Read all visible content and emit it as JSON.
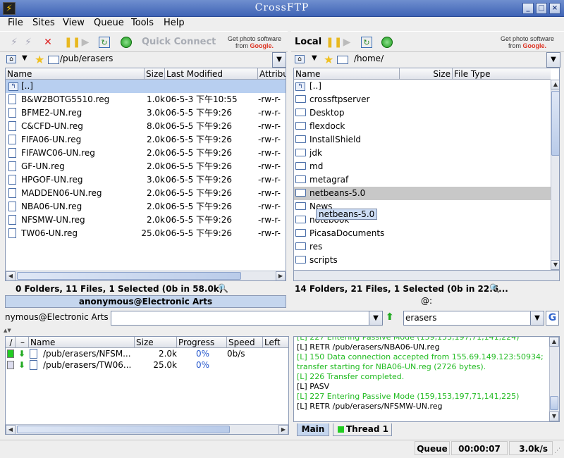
{
  "window": {
    "title": "CrossFTP",
    "app_icon": "⚡"
  },
  "menu": [
    "File",
    "Sites",
    "View",
    "Queue",
    "Tools",
    "Help"
  ],
  "remote_toolbar": {
    "quick_connect": "Quick Connect",
    "ad_line1": "Get photo software",
    "ad_line2": "from ",
    "ad_brand": "Google."
  },
  "local_toolbar": {
    "label": "Local",
    "ad_line1": "Get photo software",
    "ad_line2": "from ",
    "ad_brand": "Google."
  },
  "remote": {
    "path": "/pub/erasers",
    "columns": {
      "name": "Name",
      "size": "Size",
      "modified": "Last Modified",
      "attr": "Attribu"
    },
    "parent_row": "[..]",
    "files": [
      {
        "name": "B&W2BOTG5510.reg",
        "size": "1.0k",
        "modified": "06-5-3 下午10:55",
        "attr": "-rw-r-"
      },
      {
        "name": "BFME2-UN.reg",
        "size": "3.0k",
        "modified": "06-5-5 下午9:26",
        "attr": "-rw-r-"
      },
      {
        "name": "C&CFD-UN.reg",
        "size": "8.0k",
        "modified": "06-5-5 下午9:26",
        "attr": "-rw-r-"
      },
      {
        "name": "FIFA06-UN.reg",
        "size": "2.0k",
        "modified": "06-5-5 下午9:26",
        "attr": "-rw-r-"
      },
      {
        "name": "FIFAWC06-UN.reg",
        "size": "2.0k",
        "modified": "06-5-5 下午9:26",
        "attr": "-rw-r-"
      },
      {
        "name": "GF-UN.reg",
        "size": "2.0k",
        "modified": "06-5-5 下午9:26",
        "attr": "-rw-r-"
      },
      {
        "name": "HPGOF-UN.reg",
        "size": "3.0k",
        "modified": "06-5-5 下午9:26",
        "attr": "-rw-r-"
      },
      {
        "name": "MADDEN06-UN.reg",
        "size": "2.0k",
        "modified": "06-5-5 下午9:26",
        "attr": "-rw-r-"
      },
      {
        "name": "NBA06-UN.reg",
        "size": "2.0k",
        "modified": "06-5-5 下午9:26",
        "attr": "-rw-r-"
      },
      {
        "name": "NFSMW-UN.reg",
        "size": "2.0k",
        "modified": "06-5-5 下午9:26",
        "attr": "-rw-r-"
      },
      {
        "name": "TW06-UN.reg",
        "size": "25.0k",
        "modified": "06-5-5 下午9:26",
        "attr": "-rw-r-"
      }
    ],
    "status": "0 Folders, 11 Files, 1 Selected (0b in 58.0k)",
    "connection": "anonymous@Electronic Arts"
  },
  "local": {
    "path": "/home/",
    "columns": {
      "name": "Name",
      "size": "Size",
      "type": "File Type"
    },
    "parent_row": "[..]",
    "folders": [
      "crossftpserver",
      "Desktop",
      "flexdock",
      "InstallShield",
      "jdk",
      "md",
      "metagraf",
      "netbeans-5.0",
      "News",
      "notebook",
      "PicasaDocuments",
      "res",
      "scripts"
    ],
    "tooltip": "netbeans-5.0",
    "status": "14 Folders, 21 Files, 1 Selected (0b in 22.6...",
    "connection": "@:"
  },
  "commandbar": {
    "site_label": "nymous@Electronic Arts >",
    "command_value": "",
    "search_value": "erasers"
  },
  "queue": {
    "columns": {
      "name": "Name",
      "size": "Size",
      "progress": "Progress",
      "speed": "Speed",
      "left": "Left"
    },
    "items": [
      {
        "name": "/pub/erasers/NFSM...",
        "size": "2.0k",
        "progress": "0%",
        "speed": "0b/s",
        "left": ""
      },
      {
        "name": "/pub/erasers/TW06...",
        "size": "25.0k",
        "progress": "0%",
        "speed": "",
        "left": ""
      }
    ]
  },
  "log": {
    "lines": [
      {
        "text": "[L] 227 Entering Passive Mode (159,153,197,71,141,224)",
        "color": "green"
      },
      {
        "text": "[L] RETR /pub/erasers/NBA06-UN.reg",
        "color": "black"
      },
      {
        "text": "[L] 150 Data connection accepted from 155.69.149.123:50934;",
        "color": "green"
      },
      {
        "text": "transfer starting for NBA06-UN.reg (2726 bytes).",
        "color": "green"
      },
      {
        "text": "[L] 226 Transfer completed.",
        "color": "green"
      },
      {
        "text": "[L] PASV",
        "color": "black"
      },
      {
        "text": "[L] 227 Entering Passive Mode (159,153,197,71,141,225)",
        "color": "green"
      },
      {
        "text": "[L] RETR /pub/erasers/NFSMW-UN.reg",
        "color": "black"
      }
    ],
    "tabs": [
      "Main",
      "Thread 1"
    ]
  },
  "statusbar": {
    "label": "Queue",
    "elapsed": "00:00:07",
    "speed": "3.0k/s"
  }
}
